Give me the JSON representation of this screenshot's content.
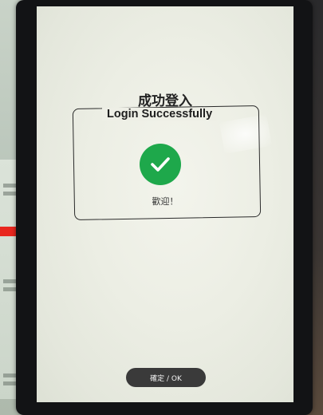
{
  "dialog": {
    "title_zh": "成功登入",
    "title_en": "Login Successfully",
    "icon": "check-circle-icon",
    "message": "歡迎！"
  },
  "footer": {
    "ok_label": "確定 / OK"
  },
  "colors": {
    "success": "#1ea84b",
    "button": "#3a3a3a",
    "arrow": "#e8261e"
  }
}
